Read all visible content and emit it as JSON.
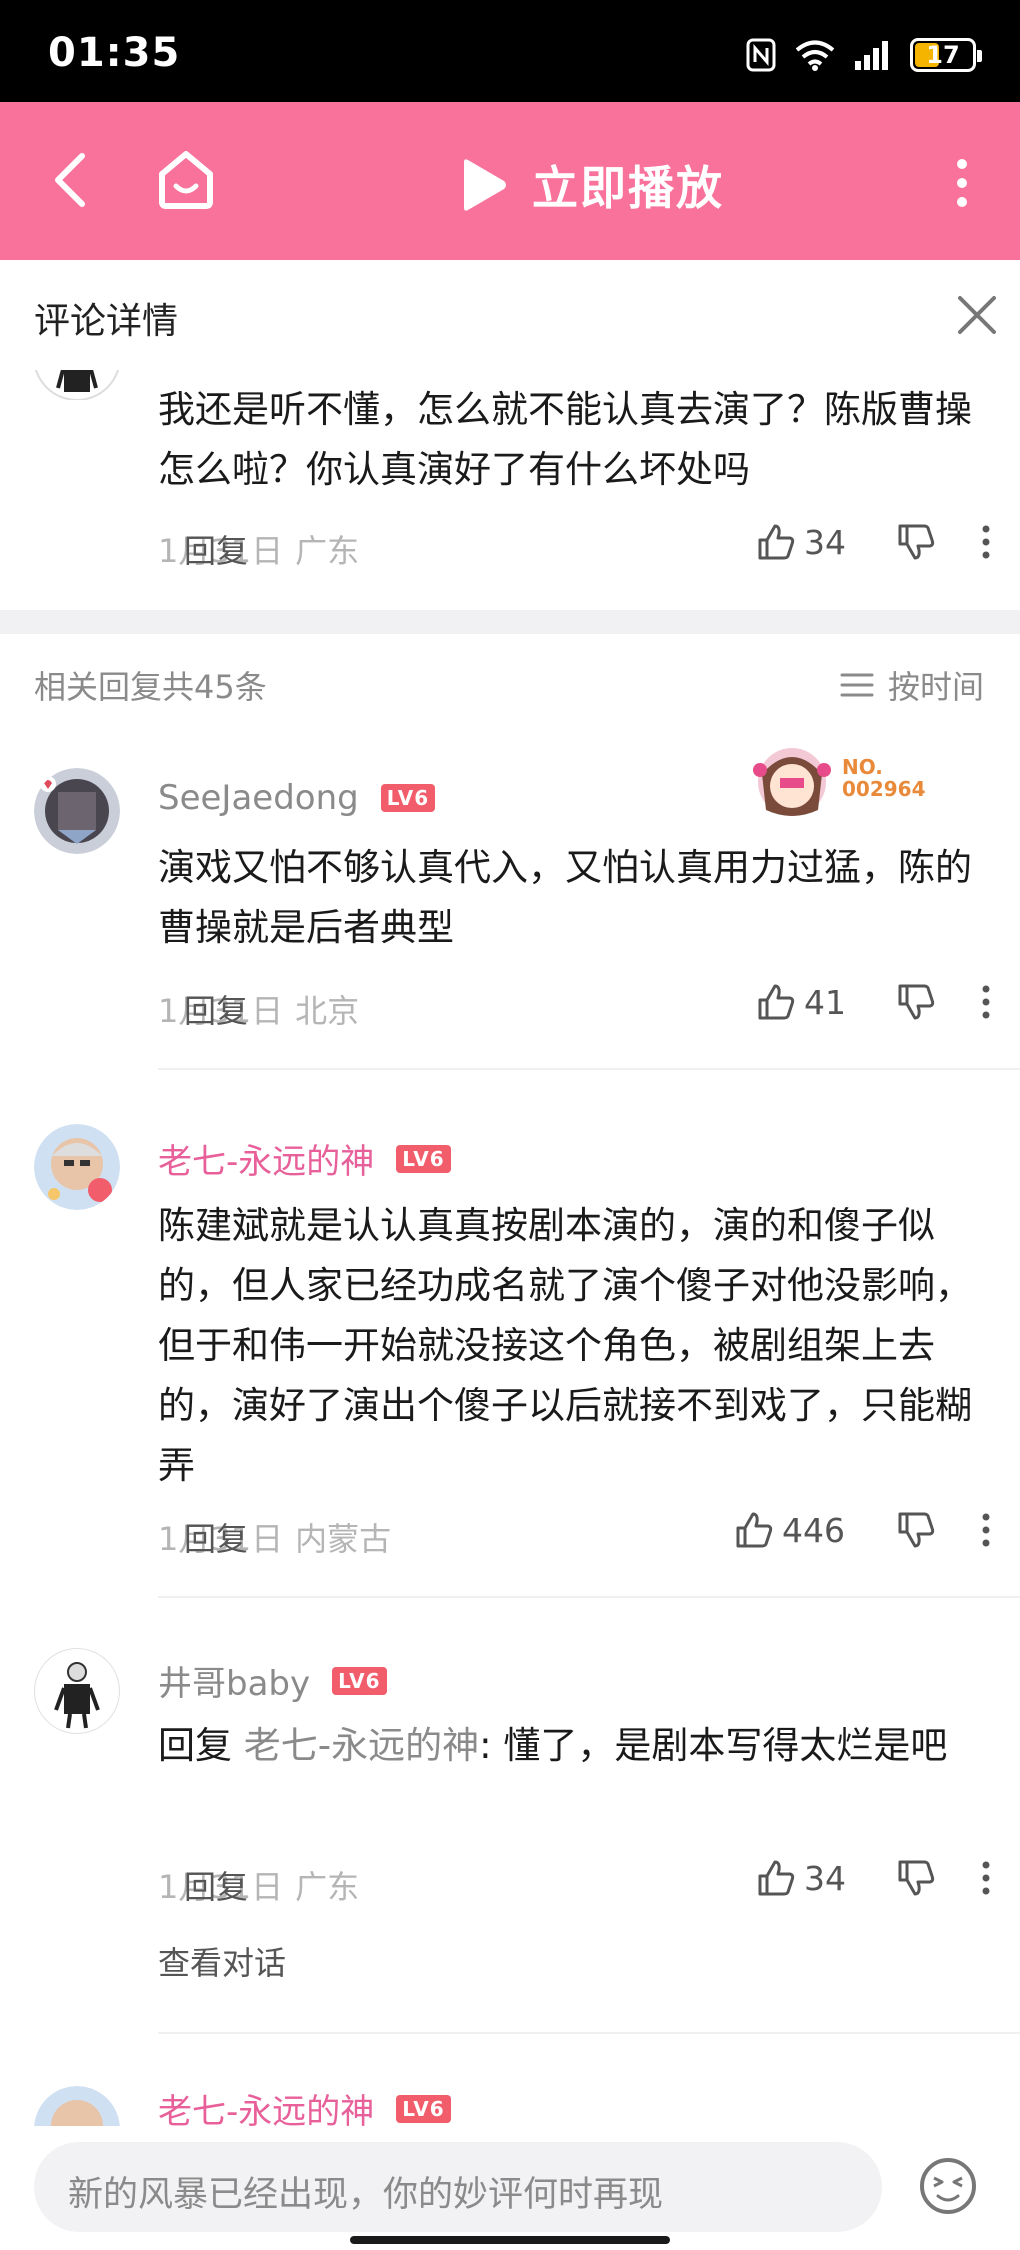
{
  "status_bar": {
    "time": "01:35",
    "battery": "17",
    "icons": [
      "nfc-icon",
      "wifi-icon",
      "signal-icon",
      "battery-icon"
    ]
  },
  "nav": {
    "play_label": "立即播放",
    "icons": [
      "back-arrow-icon",
      "home-icon",
      "play-icon",
      "more-vertical-icon"
    ]
  },
  "sheet": {
    "title": "评论详情"
  },
  "main_comment": {
    "text": "我还是听不懂，怎么就不能认真去演了？陈版曹操怎么啦？你认真演好了有什么坏处吗",
    "date": "1月31日",
    "location": "广东",
    "reply_label": "回复",
    "likes": "34"
  },
  "replies_header": {
    "count_label": "相关回复共45条",
    "sort_label": "按时间"
  },
  "replies": [
    {
      "username": "SeeJaedong",
      "level": "LV6",
      "badge_text": [
        "NO.",
        "002964"
      ],
      "text": "演戏又怕不够认真代入，又怕认真用力过猛，陈的曹操就是后者典型",
      "date": "1月31日",
      "location": "北京",
      "reply_label": "回复",
      "likes": "41"
    },
    {
      "username": "老七-永远的神",
      "level": "LV6",
      "text": "陈建斌就是认认真真按剧本演的，演的和傻子似的，但人家已经功成名就了演个傻子对他没影响，但于和伟一开始就没接这个角色，被剧组架上去的，演好了演出个傻子以后就接不到戏了，只能糊弄",
      "date": "1月31日",
      "location": "内蒙古",
      "reply_label": "回复",
      "likes": "446"
    },
    {
      "username": "井哥baby",
      "level": "LV6",
      "reply_prefix": "回复 ",
      "reply_to": "老七-永远的神",
      "text": ": 懂了，是剧本写得太烂是吧",
      "date": "1月31日",
      "location": "广东",
      "reply_label": "回复",
      "likes": "34",
      "view_dialog": "查看对话"
    },
    {
      "username": "老七-永远的神",
      "level": "LV6"
    }
  ],
  "input": {
    "placeholder": "新的风暴已经出现，你的妙评何时再现"
  },
  "colors": {
    "accent_pink": "#f8729c",
    "username_pink": "#e8609a",
    "level_red": "#f25d6c"
  }
}
